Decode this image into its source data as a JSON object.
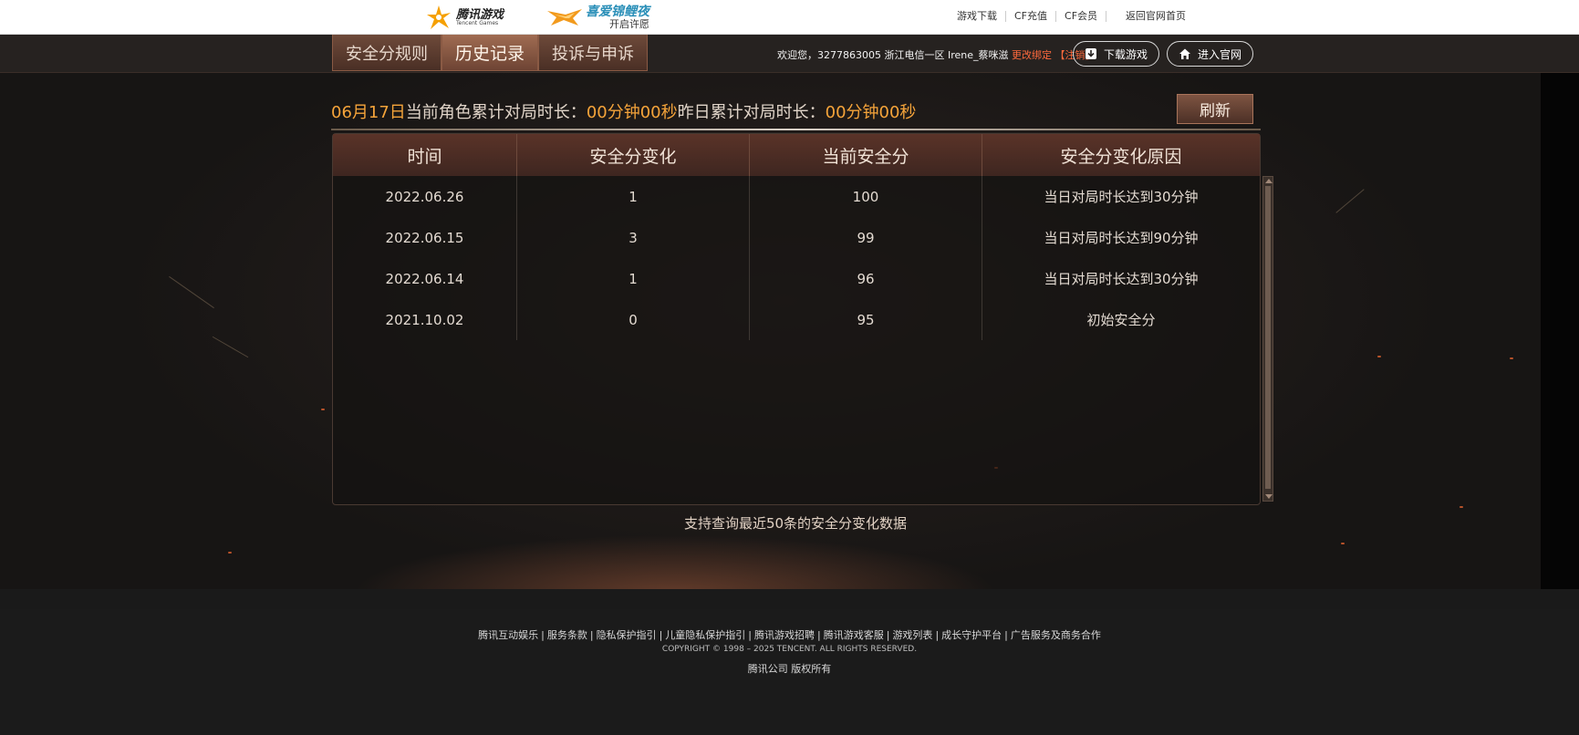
{
  "brand": {
    "tencent_games_cn": "腾讯游戏",
    "tencent_games_en": "Tencent Games",
    "cf_line1": "喜爱锦鲤夜",
    "cf_line2": "开启许愿"
  },
  "top_links": [
    "游戏下载",
    "CF充值",
    "CF会员",
    "返回官网首页"
  ],
  "tabs": [
    {
      "label": "安全分规则"
    },
    {
      "label": "历史记录"
    },
    {
      "label": "投诉与申诉"
    }
  ],
  "user": {
    "welcome": "欢迎您，3277863005 浙江电信一区 Irene_蔡咪滋",
    "change_bind": "更改绑定",
    "logout": "【注销】"
  },
  "buttons": {
    "download": "下载游戏",
    "enter_site": "进入官网",
    "refresh": "刷新"
  },
  "stats": {
    "date": "06月17日",
    "current_label": "当前角色累计对局时长：",
    "current_value": "00分钟00秒",
    "yesterday_label": "昨日累计对局时长：",
    "yesterday_value": "00分钟00秒"
  },
  "table": {
    "headers": [
      "时间",
      "安全分变化",
      "当前安全分",
      "安全分变化原因"
    ],
    "rows": [
      [
        "2022.06.26",
        "1",
        "100",
        "当日对局时长达到30分钟"
      ],
      [
        "2022.06.15",
        "3",
        "99",
        "当日对局时长达到90分钟"
      ],
      [
        "2022.06.14",
        "1",
        "96",
        "当日对局时长达到30分钟"
      ],
      [
        "2021.10.02",
        "0",
        "95",
        "初始安全分"
      ]
    ]
  },
  "note": "支持查询最近50条的安全分变化数据",
  "footer": {
    "links": [
      "腾讯互动娱乐",
      "服务条款",
      "隐私保护指引",
      "儿童隐私保护指引",
      "腾讯游戏招聘",
      "腾讯游戏客服",
      "游戏列表",
      "成长守护平台",
      "广告服务及商务合作"
    ],
    "copyright": "COPYRIGHT © 1998 – 2025 TENCENT. ALL RIGHTS RESERVED.",
    "rights": "腾讯公司 版权所有"
  },
  "colors": {
    "accent_yellow": "#f5a43a",
    "highlight_red": "#ff6a3d",
    "tab_brown": "#6e4a3a",
    "background": "#1a1a1a"
  },
  "icons": [
    "tencent-games-logo-icon",
    "cf-emblem-icon",
    "download-icon",
    "home-icon",
    "scroll-up-icon",
    "scroll-down-icon"
  ]
}
